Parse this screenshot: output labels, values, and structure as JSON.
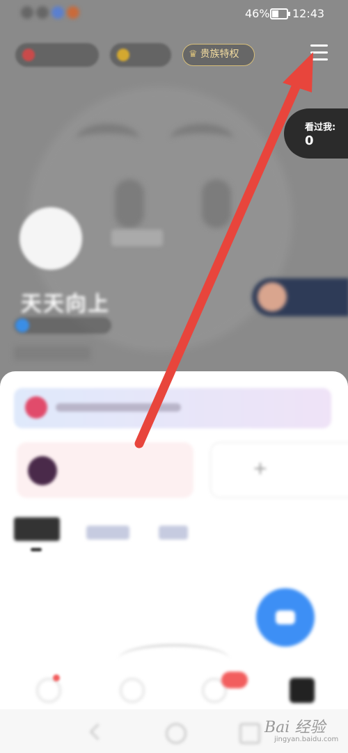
{
  "status_bar": {
    "battery_percent": "46%",
    "time": "12:43"
  },
  "header": {
    "vip_label": "贵族特权",
    "visitors_label": "看过我:",
    "visitors_count": "0",
    "username": "天天向上"
  },
  "watermark": {
    "text": "Bai 经验",
    "sub": "jingyan.baidu.com"
  },
  "colors": {
    "arrow": "#e8453c",
    "header_bg": "#8a8a8a",
    "vip_gold": "#d8bf7a",
    "fab_blue": "#3d8ff5"
  }
}
